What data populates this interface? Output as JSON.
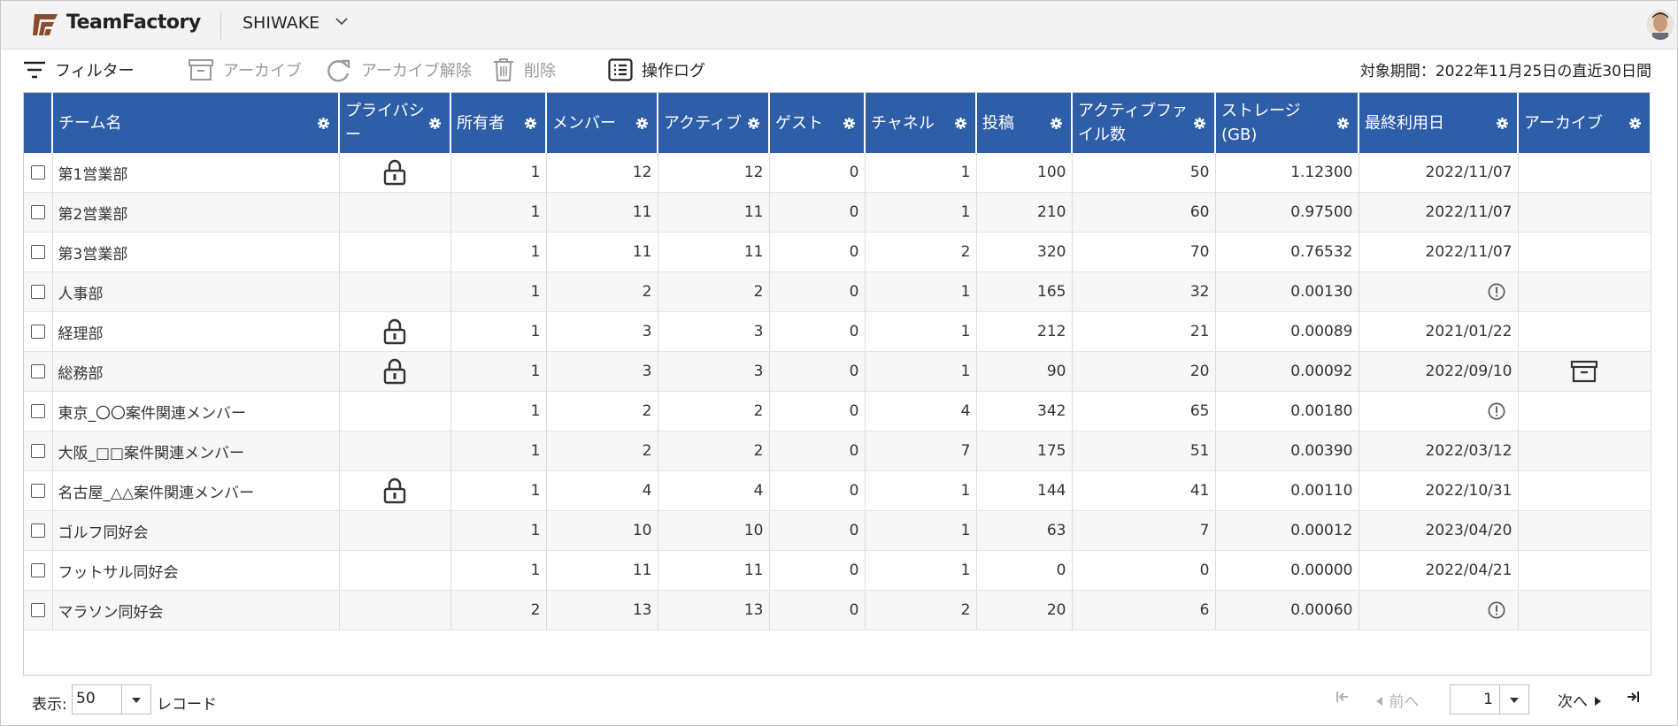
{
  "app": {
    "name": "TeamFactory",
    "workspace": "SHIWAKE"
  },
  "toolbar": {
    "filter": "フィルター",
    "archive": "アーカイブ",
    "unarchive": "アーカイブ解除",
    "delete": "削除",
    "oplog": "操作ログ",
    "period": "対象期間：2022年11月25日の直近30日間"
  },
  "columns": [
    "チーム名",
    "プライバシー",
    "所有者",
    "メンバー",
    "アクティブ",
    "ゲスト",
    "チャネル",
    "投稿",
    "アクティブファイル数",
    "ストレージ(GB)",
    "最終利用日",
    "アーカイブ"
  ],
  "rows": [
    {
      "name": "第1営業部",
      "private": true,
      "owners": "1",
      "members": "12",
      "active": "12",
      "guests": "0",
      "channels": "1",
      "posts": "100",
      "files": "50",
      "storage": "1.12300",
      "last": "2022/11/07",
      "warn": false,
      "archived": false
    },
    {
      "name": "第2営業部",
      "private": false,
      "owners": "1",
      "members": "11",
      "active": "11",
      "guests": "0",
      "channels": "1",
      "posts": "210",
      "files": "60",
      "storage": "0.97500",
      "last": "2022/11/07",
      "warn": false,
      "archived": false
    },
    {
      "name": "第3営業部",
      "private": false,
      "owners": "1",
      "members": "11",
      "active": "11",
      "guests": "0",
      "channels": "2",
      "posts": "320",
      "files": "70",
      "storage": "0.76532",
      "last": "2022/11/07",
      "warn": false,
      "archived": false
    },
    {
      "name": "人事部",
      "private": false,
      "owners": "1",
      "members": "2",
      "active": "2",
      "guests": "0",
      "channels": "1",
      "posts": "165",
      "files": "32",
      "storage": "0.00130",
      "last": "",
      "warn": true,
      "archived": false
    },
    {
      "name": "経理部",
      "private": true,
      "owners": "1",
      "members": "3",
      "active": "3",
      "guests": "0",
      "channels": "1",
      "posts": "212",
      "files": "21",
      "storage": "0.00089",
      "last": "2021/01/22",
      "warn": false,
      "archived": false
    },
    {
      "name": "総務部",
      "private": true,
      "owners": "1",
      "members": "3",
      "active": "3",
      "guests": "0",
      "channels": "1",
      "posts": "90",
      "files": "20",
      "storage": "0.00092",
      "last": "2022/09/10",
      "warn": false,
      "archived": true
    },
    {
      "name": "東京_〇〇案件関連メンバー",
      "private": false,
      "owners": "1",
      "members": "2",
      "active": "2",
      "guests": "0",
      "channels": "4",
      "posts": "342",
      "files": "65",
      "storage": "0.00180",
      "last": "",
      "warn": true,
      "archived": false
    },
    {
      "name": "大阪_□□案件関連メンバー",
      "private": false,
      "owners": "1",
      "members": "2",
      "active": "2",
      "guests": "0",
      "channels": "7",
      "posts": "175",
      "files": "51",
      "storage": "0.00390",
      "last": "2022/03/12",
      "warn": false,
      "archived": false
    },
    {
      "name": "名古屋_△△案件関連メンバー",
      "private": true,
      "owners": "1",
      "members": "4",
      "active": "4",
      "guests": "0",
      "channels": "1",
      "posts": "144",
      "files": "41",
      "storage": "0.00110",
      "last": "2022/10/31",
      "warn": false,
      "archived": false
    },
    {
      "name": "ゴルフ同好会",
      "private": false,
      "owners": "1",
      "members": "10",
      "active": "10",
      "guests": "0",
      "channels": "1",
      "posts": "63",
      "files": "7",
      "storage": "0.00012",
      "last": "2023/04/20",
      "warn": false,
      "archived": false
    },
    {
      "name": "フットサル同好会",
      "private": false,
      "owners": "1",
      "members": "11",
      "active": "11",
      "guests": "0",
      "channels": "1",
      "posts": "0",
      "files": "0",
      "storage": "0.00000",
      "last": "2022/04/21",
      "warn": false,
      "archived": false
    },
    {
      "name": "マラソン同好会",
      "private": false,
      "owners": "2",
      "members": "13",
      "active": "13",
      "guests": "0",
      "channels": "2",
      "posts": "20",
      "files": "6",
      "storage": "0.00060",
      "last": "",
      "warn": true,
      "archived": false
    }
  ],
  "footer": {
    "show_label": "表示:",
    "page_size": "50",
    "records_label": "レコード",
    "prev": "前へ",
    "page": "1",
    "next": "次へ"
  },
  "colors": {
    "header_bg": "#2e5ea8",
    "accent_logo": "#8a4b2b"
  },
  "icons": [
    "filter-icon",
    "archive-icon",
    "unarchive-icon",
    "trash-icon",
    "list-icon",
    "gear-icon",
    "lock-icon",
    "warning-icon",
    "first-page-icon",
    "last-page-icon"
  ]
}
